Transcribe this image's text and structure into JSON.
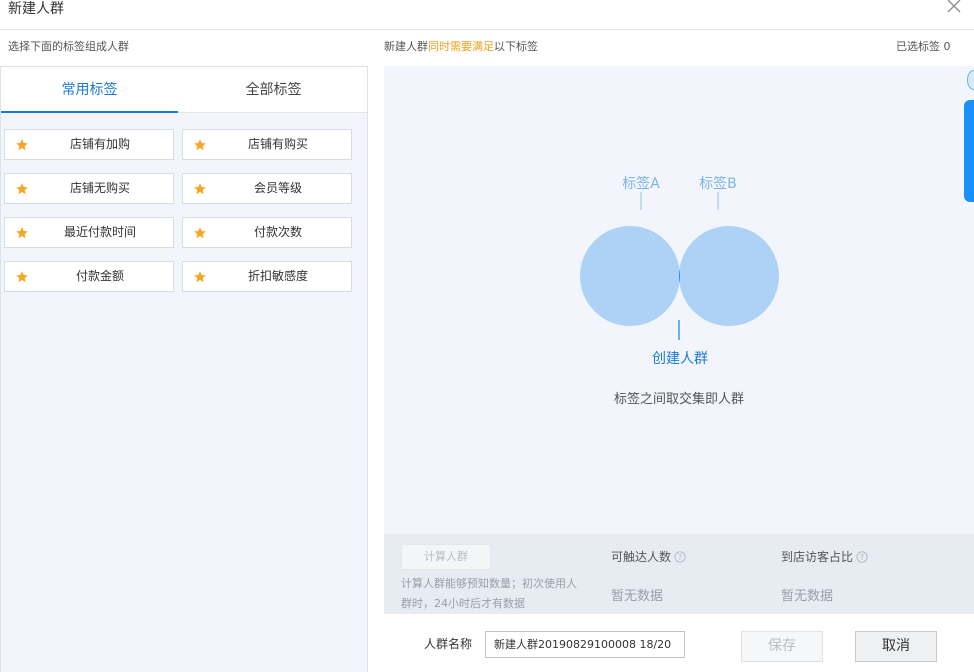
{
  "dialog": {
    "title": "新建人群"
  },
  "left": {
    "subtitle": "选择下面的标签组成人群",
    "tabs": [
      {
        "label": "常用标签",
        "active": true
      },
      {
        "label": "全部标签",
        "active": false
      }
    ],
    "tags": [
      {
        "label": "店铺有加购",
        "icon": "star-icon"
      },
      {
        "label": "店铺有购买",
        "icon": "star-icon"
      },
      {
        "label": "店铺无购买",
        "icon": "star-icon"
      },
      {
        "label": "会员等级",
        "icon": "star-icon"
      },
      {
        "label": "最近付款时间",
        "icon": "star-icon"
      },
      {
        "label": "付款次数",
        "icon": "star-icon"
      },
      {
        "label": "付款金额",
        "icon": "star-icon"
      },
      {
        "label": "折扣敏感度",
        "icon": "star-icon"
      }
    ]
  },
  "right": {
    "header_prefix": "新建人群",
    "header_highlight": "同时需要满足",
    "header_suffix": "以下标签",
    "selected_count_label": "已选标签  0",
    "venn": {
      "label_a": "标签A",
      "label_b": "标签B",
      "center_label": "创建人群",
      "hint": "标签之间取交集即人群"
    }
  },
  "stats": {
    "calc_button": "计算人群",
    "calc_desc": "计算人群能够预知数量；初次使用人群时，24小时后才有数据",
    "reach_label": "可触达人数",
    "reach_value": "暂无数据",
    "visitor_label": "到店访客占比",
    "visitor_value": "暂无数据"
  },
  "footer": {
    "name_label": "人群名称",
    "name_value": "新建人群20190829100008   18/20",
    "save_label": "保存",
    "cancel_label": "取消"
  },
  "colors": {
    "accent": "#1a7ad6",
    "highlight": "#f0a020",
    "star": "#f5a623",
    "venn_light": "#a9d0f5",
    "venn_dark": "#1483e3"
  }
}
